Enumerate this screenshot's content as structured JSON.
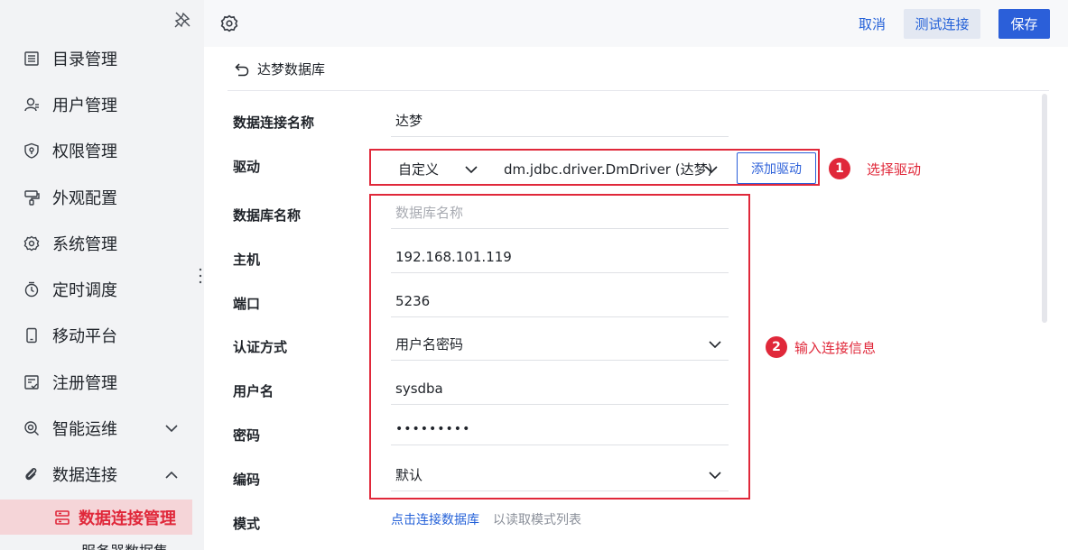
{
  "sidebar": {
    "items": [
      {
        "label": "目录管理",
        "icon": "catalog-icon"
      },
      {
        "label": "用户管理",
        "icon": "user-icon"
      },
      {
        "label": "权限管理",
        "icon": "shield-icon"
      },
      {
        "label": "外观配置",
        "icon": "brush-icon"
      },
      {
        "label": "系统管理",
        "icon": "gear-icon"
      },
      {
        "label": "定时调度",
        "icon": "timer-icon"
      },
      {
        "label": "移动平台",
        "icon": "mobile-icon"
      },
      {
        "label": "注册管理",
        "icon": "register-icon"
      },
      {
        "label": "智能运维",
        "icon": "ops-icon"
      },
      {
        "label": "数据连接",
        "icon": "link-icon"
      }
    ],
    "active_sub": {
      "label": "数据连接管理",
      "icon": "database-icon"
    },
    "next_sub_partial": "服务器数据集"
  },
  "topbar": {
    "cancel": "取消",
    "test": "测试连接",
    "save": "保存"
  },
  "panel": {
    "back_title": "达梦数据库",
    "fields": {
      "conn_name": {
        "label": "数据连接名称",
        "value": "达梦"
      },
      "driver": {
        "label": "驱动",
        "type_value": "自定义",
        "class_value": "dm.jdbc.driver.DmDriver (达梦)",
        "add_button": "添加驱动"
      },
      "db_name": {
        "label": "数据库名称",
        "placeholder": "数据库名称"
      },
      "host": {
        "label": "主机",
        "value": "192.168.101.119"
      },
      "port": {
        "label": "端口",
        "value": "5236"
      },
      "auth": {
        "label": "认证方式",
        "value": "用户名密码"
      },
      "username": {
        "label": "用户名",
        "value": "sysdba"
      },
      "password": {
        "label": "密码",
        "value": "•••••••••"
      },
      "encoding": {
        "label": "编码",
        "value": "默认"
      },
      "mode": {
        "label": "模式",
        "link": "点击连接数据库",
        "hint": "以读取模式列表"
      }
    },
    "annotations": [
      {
        "number": "1",
        "text": "选择驱动"
      },
      {
        "number": "2",
        "text": "输入连接信息"
      }
    ]
  },
  "colors": {
    "accent": "#2b5fd9",
    "highlight": "#e0283a",
    "active_bg": "#f5d5d8"
  }
}
